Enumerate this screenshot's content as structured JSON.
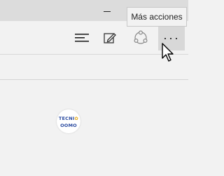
{
  "titlebar": {
    "minimize": "minimize"
  },
  "tooltip": {
    "text": "Más acciones"
  },
  "toolbar": {
    "buttons": [
      {
        "icon": "hub-icon"
      },
      {
        "icon": "web-note-icon"
      },
      {
        "icon": "share-icon"
      },
      {
        "icon": "more-actions-icon",
        "glyph": "···"
      }
    ]
  },
  "content": {
    "logo": {
      "line1": "TECNI",
      "line2": "OOMO"
    }
  },
  "colors": {
    "titlebar": "#dcdcdc",
    "toolbar": "#f2f2f2",
    "hover": "#d8d8d8",
    "logo_text": "#2a4aa0"
  }
}
